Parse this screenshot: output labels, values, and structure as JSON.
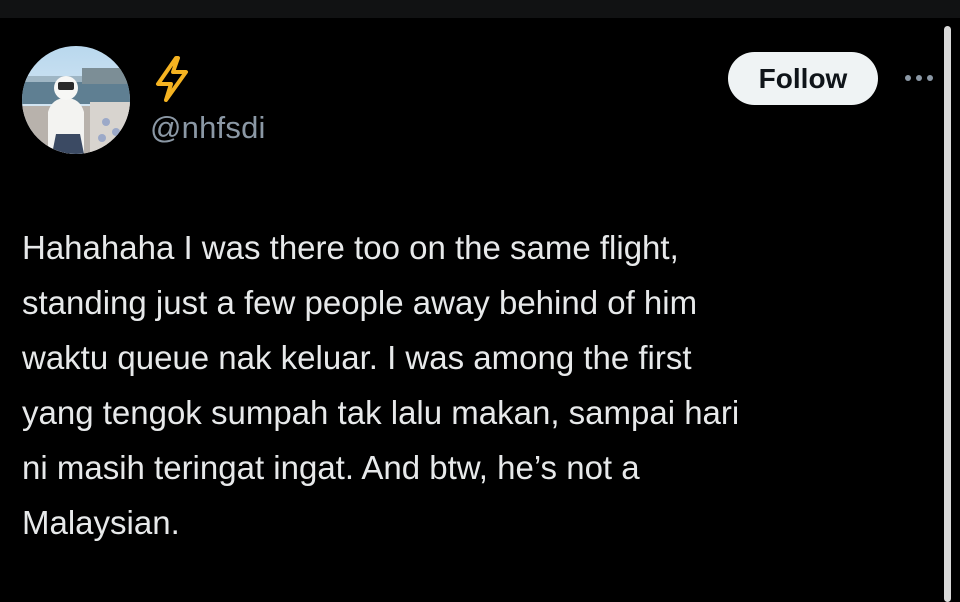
{
  "author": {
    "display_name_icon": "lightning-bolt-emoji",
    "handle": "@nhfsdi"
  },
  "actions": {
    "follow_label": "Follow",
    "more_icon": "more-options-icon"
  },
  "tweet": {
    "lines": [
      "Hahahaha I was there too on the same flight,",
      "standing just a few people away behind of him",
      "waktu queue nak keluar. I was among the first",
      "yang tengok sumpah tak lalu makan, sampai hari",
      "ni masih teringat ingat. And btw, he’s not a",
      "Malaysian."
    ]
  },
  "colors": {
    "background": "#000000",
    "text": "#e7e9ea",
    "secondary_text": "#8b98a5",
    "follow_button_bg": "#eff3f4",
    "follow_button_text": "#0f1419",
    "bolt": "#f5b321"
  }
}
